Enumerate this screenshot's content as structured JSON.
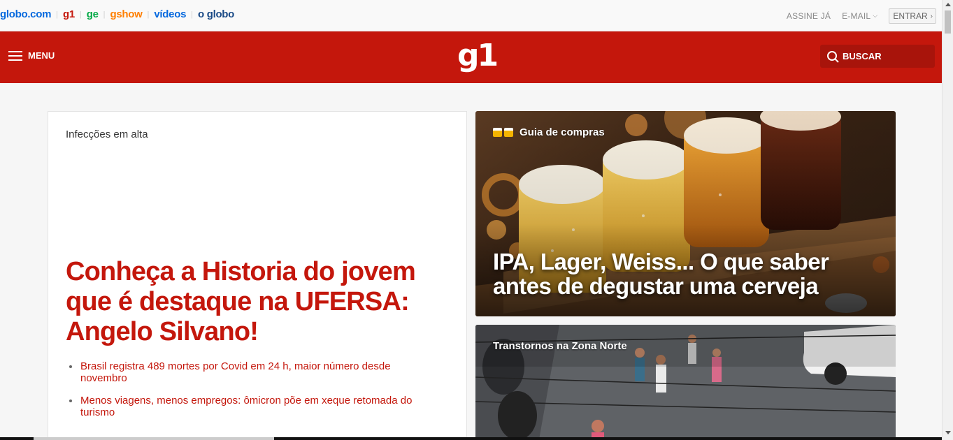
{
  "globobar": {
    "brands": [
      {
        "label": "globo.com",
        "color": "#0669de"
      },
      {
        "label": "g1",
        "color": "#c4170c"
      },
      {
        "label": "ge",
        "color": "#06aa48"
      },
      {
        "label": "gshow",
        "color": "#ff7f00"
      },
      {
        "label": "vídeos",
        "color": "#0669de"
      },
      {
        "label": "o globo",
        "color": "#1a4a86"
      }
    ],
    "subscribe": "ASSINE JÁ",
    "email": "E-MAIL",
    "login": "ENTRAR"
  },
  "header": {
    "menu_label": "MENU",
    "logo": "g1",
    "search_label": "BUSCAR",
    "color": "#c4170c"
  },
  "main_story": {
    "kicker": "Infecções em alta",
    "headline": "Conheça a Historia do jovem que é destaque na UFERSA: Angelo Silvano!",
    "related": [
      "Brasil registra 489 mortes por Covid em 24 h, maior número desde novembro",
      "Menos viagens, menos empregos: ômicron põe em xeque retomada do turismo"
    ]
  },
  "feature_1": {
    "label": "Guia de compras",
    "label_icon": "beer-mugs-icon",
    "title": "IPA, Lager, Weiss... O que saber antes de degustar uma cerveja"
  },
  "feature_2": {
    "label": "Transtornos na Zona Norte"
  }
}
